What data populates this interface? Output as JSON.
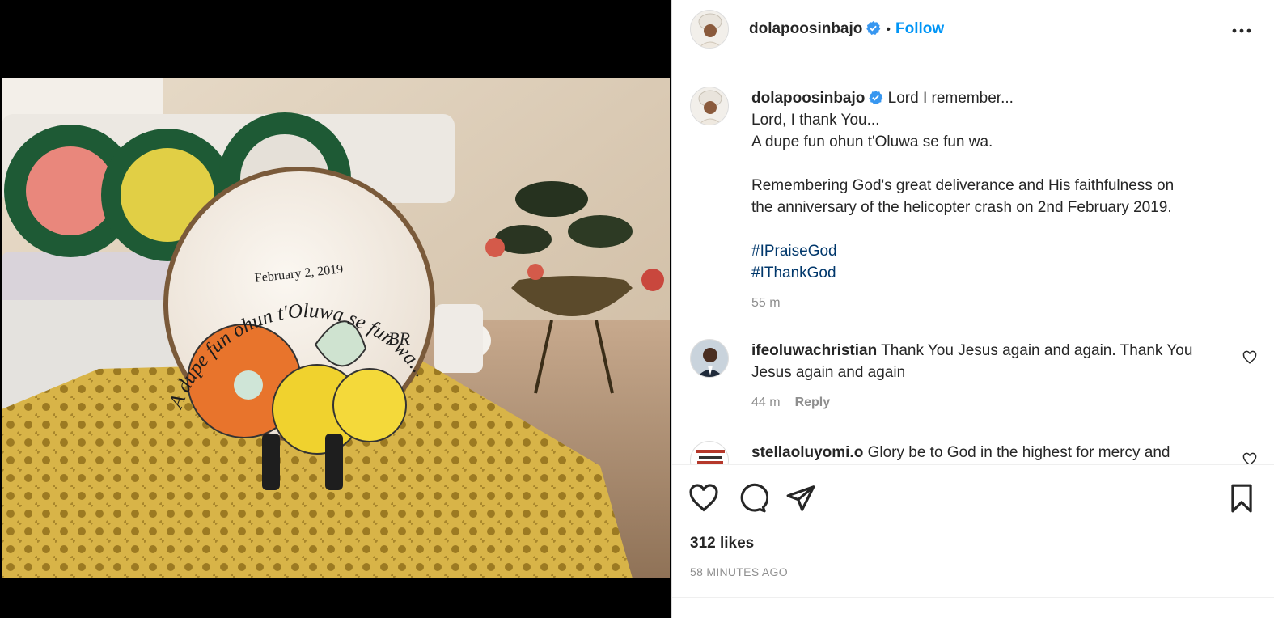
{
  "post": {
    "username": "dolapoosinbajo",
    "follow_label": "Follow",
    "dot": "•",
    "image_alt": "Commemorative plate with floral design on crocheted doily",
    "plate_text": "A dupe fun ohun t'Oluwa se fun wa...",
    "plate_date": "February 2, 2019",
    "plate_monogram": "BR"
  },
  "caption": {
    "username": "dolapoosinbajo",
    "line1": "Lord I remember...",
    "line2": "Lord, I thank You...",
    "line3": "A dupe fun ohun t'Oluwa se fun wa.",
    "para1": "Remembering God's great deliverance and His faithfulness on",
    "para2": "the anniversary of the helicopter crash on 2nd February 2019.",
    "hashtag1": "#IPraiseGod",
    "hashtag2": "#IThankGod",
    "time": "55 m"
  },
  "comments": [
    {
      "username": "ifeoluwachristian",
      "text1": "Thank You Jesus again and again. Thank You",
      "text2": "Jesus again and again",
      "time": "44 m",
      "reply_label": "Reply"
    },
    {
      "username": "stellaoluyomi.o",
      "text1": "Glory be to God in the highest for mercy and"
    }
  ],
  "footer": {
    "likes": "312 likes",
    "time_ago": "58 MINUTES AGO"
  },
  "colors": {
    "follow_blue": "#0095f6",
    "hashtag_blue": "#00376b",
    "meta_gray": "#8e8e8e",
    "verified_blue": "#3897f0"
  }
}
